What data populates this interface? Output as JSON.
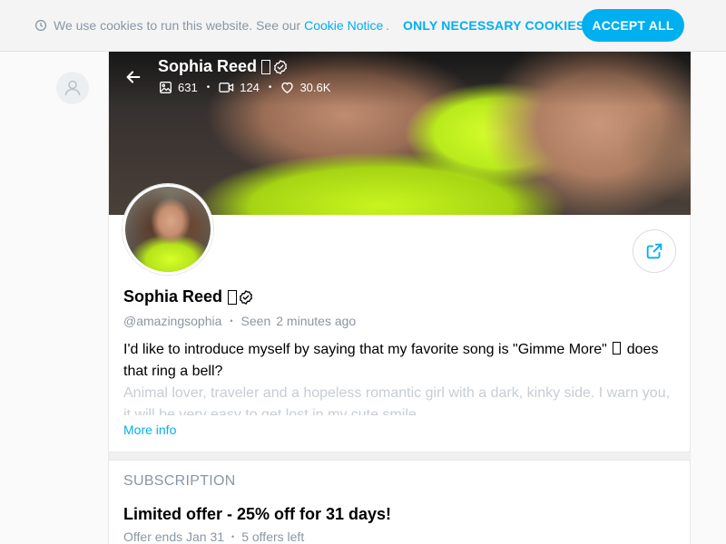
{
  "cookie": {
    "text": "We use cookies to run this website. See our",
    "link": "Cookie Notice",
    "dot": ".",
    "only_necessary": "ONLY NECESSARY COOKIES",
    "accept_all": "ACCEPT ALL"
  },
  "cover": {
    "name": "Sophia Reed",
    "stats": {
      "photos": "631",
      "videos": "124",
      "likes": "30.6K"
    }
  },
  "profile": {
    "name": "Sophia Reed",
    "handle": "@amazingsophia",
    "seen_label": "Seen",
    "seen_time": "2 minutes ago",
    "bio_part1": "I'd like to introduce myself by saying that my favorite song is \"Gimme More\"",
    "bio_part2": "does that ring a bell?",
    "bio_faded": "Animal lover, traveler and a hopeless romantic girl with a dark, kinky side. I warn you, it will be very easy to get lost in my cute smile",
    "more_info": "More info"
  },
  "subscription": {
    "title": "SUBSCRIPTION",
    "offer": "Limited offer - 25% off for 31 days!",
    "ends": "Offer ends Jan 31",
    "left": "5 offers left"
  },
  "colors": {
    "accent": "#00aff0",
    "muted": "#8a96a3",
    "neon": "#c8f51e"
  },
  "icons": [
    "clock-icon",
    "user-icon",
    "back-arrow-icon",
    "verified-icon",
    "image-icon",
    "video-icon",
    "heart-icon",
    "share-icon"
  ]
}
